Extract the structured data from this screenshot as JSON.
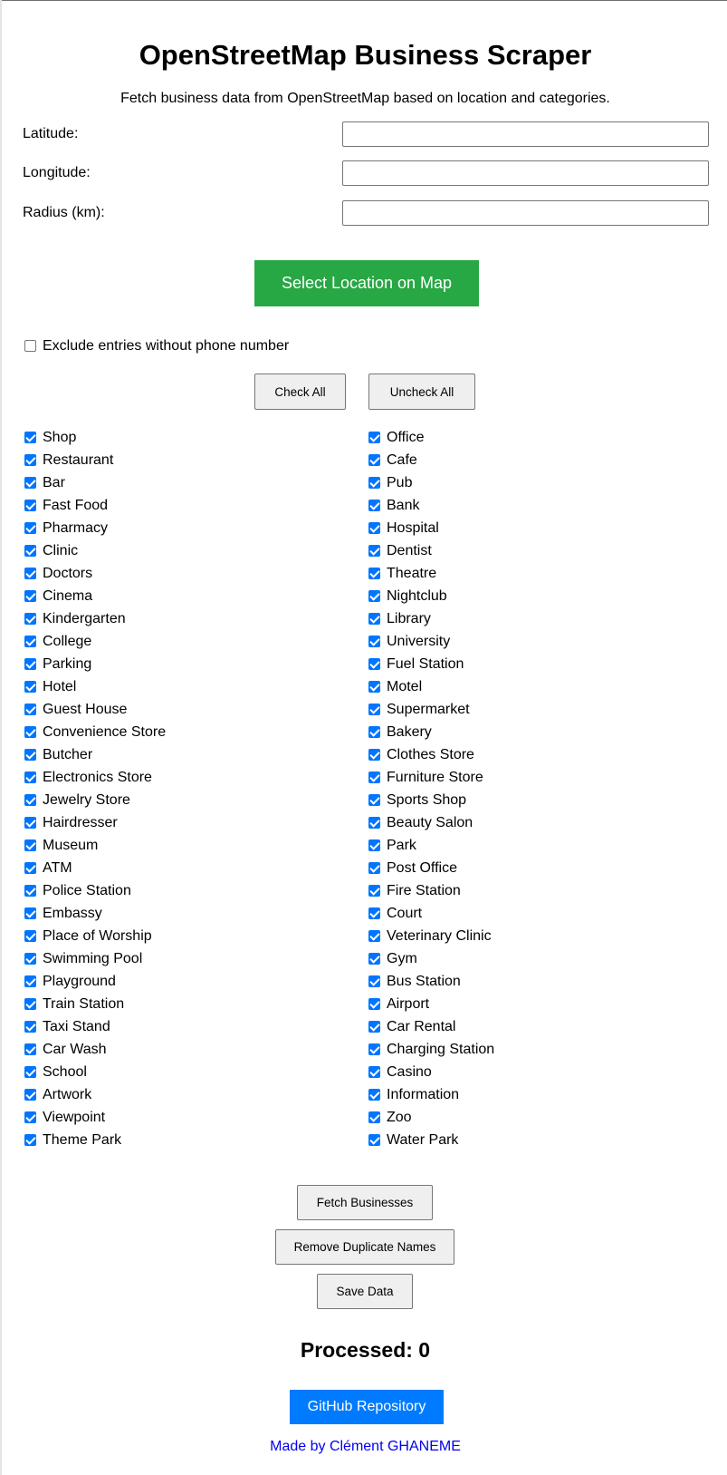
{
  "page": {
    "title": "OpenStreetMap Business Scraper",
    "subtitle": "Fetch business data from OpenStreetMap based on location and categories."
  },
  "form": {
    "latitude_label": "Latitude:",
    "latitude_value": "",
    "longitude_label": "Longitude:",
    "longitude_value": "",
    "radius_label": "Radius (km):",
    "radius_value": ""
  },
  "map_button": "Select Location on Map",
  "exclude_phone": {
    "label": "Exclude entries without phone number",
    "checked": false
  },
  "bulk": {
    "check_all": "Check All",
    "uncheck_all": "Uncheck All"
  },
  "categories_left": [
    {
      "label": "Shop",
      "checked": true
    },
    {
      "label": "Restaurant",
      "checked": true
    },
    {
      "label": "Bar",
      "checked": true
    },
    {
      "label": "Fast Food",
      "checked": true
    },
    {
      "label": "Pharmacy",
      "checked": true
    },
    {
      "label": "Clinic",
      "checked": true
    },
    {
      "label": "Doctors",
      "checked": true
    },
    {
      "label": "Cinema",
      "checked": true
    },
    {
      "label": "Kindergarten",
      "checked": true
    },
    {
      "label": "College",
      "checked": true
    },
    {
      "label": "Parking",
      "checked": true
    },
    {
      "label": "Hotel",
      "checked": true
    },
    {
      "label": "Guest House",
      "checked": true
    },
    {
      "label": "Convenience Store",
      "checked": true
    },
    {
      "label": "Butcher",
      "checked": true
    },
    {
      "label": "Electronics Store",
      "checked": true
    },
    {
      "label": "Jewelry Store",
      "checked": true
    },
    {
      "label": "Hairdresser",
      "checked": true
    },
    {
      "label": "Museum",
      "checked": true
    },
    {
      "label": "ATM",
      "checked": true
    },
    {
      "label": "Police Station",
      "checked": true
    },
    {
      "label": "Embassy",
      "checked": true
    },
    {
      "label": "Place of Worship",
      "checked": true
    },
    {
      "label": "Swimming Pool",
      "checked": true
    },
    {
      "label": "Playground",
      "checked": true
    },
    {
      "label": "Train Station",
      "checked": true
    },
    {
      "label": "Taxi Stand",
      "checked": true
    },
    {
      "label": "Car Wash",
      "checked": true
    },
    {
      "label": "School",
      "checked": true
    },
    {
      "label": "Artwork",
      "checked": true
    },
    {
      "label": "Viewpoint",
      "checked": true
    },
    {
      "label": "Theme Park",
      "checked": true
    }
  ],
  "categories_right": [
    {
      "label": "Office",
      "checked": true
    },
    {
      "label": "Cafe",
      "checked": true
    },
    {
      "label": "Pub",
      "checked": true
    },
    {
      "label": "Bank",
      "checked": true
    },
    {
      "label": "Hospital",
      "checked": true
    },
    {
      "label": "Dentist",
      "checked": true
    },
    {
      "label": "Theatre",
      "checked": true
    },
    {
      "label": "Nightclub",
      "checked": true
    },
    {
      "label": "Library",
      "checked": true
    },
    {
      "label": "University",
      "checked": true
    },
    {
      "label": "Fuel Station",
      "checked": true
    },
    {
      "label": "Motel",
      "checked": true
    },
    {
      "label": "Supermarket",
      "checked": true
    },
    {
      "label": "Bakery",
      "checked": true
    },
    {
      "label": "Clothes Store",
      "checked": true
    },
    {
      "label": "Furniture Store",
      "checked": true
    },
    {
      "label": "Sports Shop",
      "checked": true
    },
    {
      "label": "Beauty Salon",
      "checked": true
    },
    {
      "label": "Park",
      "checked": true
    },
    {
      "label": "Post Office",
      "checked": true
    },
    {
      "label": "Fire Station",
      "checked": true
    },
    {
      "label": "Court",
      "checked": true
    },
    {
      "label": "Veterinary Clinic",
      "checked": true
    },
    {
      "label": "Gym",
      "checked": true
    },
    {
      "label": "Bus Station",
      "checked": true
    },
    {
      "label": "Airport",
      "checked": true
    },
    {
      "label": "Car Rental",
      "checked": true
    },
    {
      "label": "Charging Station",
      "checked": true
    },
    {
      "label": "Casino",
      "checked": true
    },
    {
      "label": "Information",
      "checked": true
    },
    {
      "label": "Zoo",
      "checked": true
    },
    {
      "label": "Water Park",
      "checked": true
    }
  ],
  "actions": {
    "fetch": "Fetch Businesses",
    "dedupe": "Remove Duplicate Names",
    "save": "Save Data"
  },
  "processed_text": "Processed: 0",
  "github_button": "GitHub Repository",
  "credit": "Made by Clément GHANEME",
  "colors": {
    "map_button": "#28a745",
    "github_button": "#007bff",
    "checkbox_checked": "#0075ff",
    "link": "#0000ee"
  }
}
